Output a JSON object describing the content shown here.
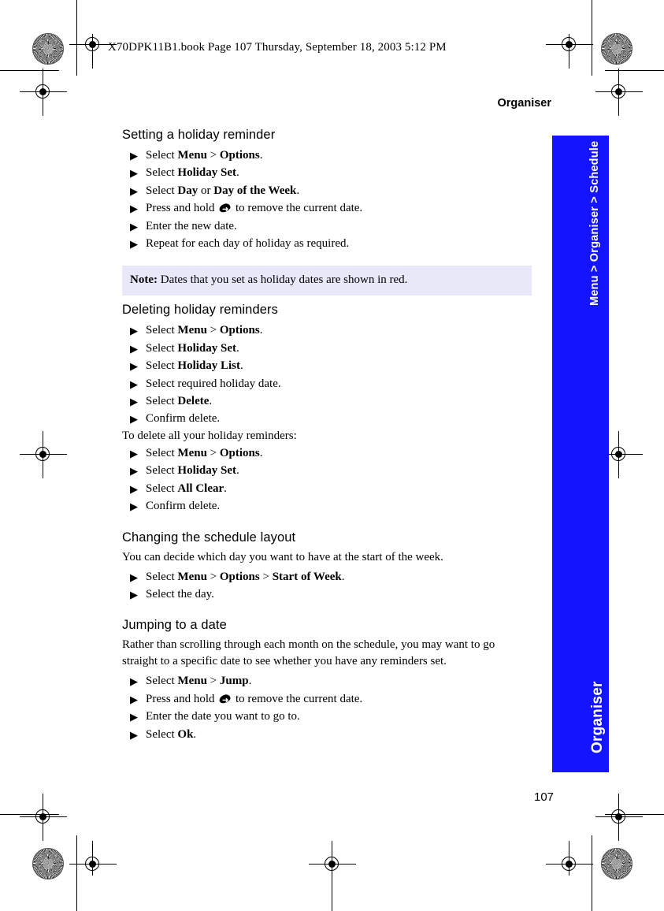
{
  "print_header": "X70DPK11B1.book  Page 107  Thursday, September 18, 2003  5:12 PM",
  "running_head": "Organiser",
  "folio": "107",
  "side_tab": {
    "breadcrumb": "Menu > Organiser > Schedule",
    "chapter": "Organiser",
    "color": "#1414ff"
  },
  "note": {
    "label": "Note:",
    "text": " Dates that you set as holiday dates are shown in red.",
    "background": "#e8e8f8"
  },
  "sections": [
    {
      "heading": "Setting a holiday reminder",
      "steps": [
        {
          "bullet": "▶",
          "parts": [
            {
              "t": "Select ",
              "b": false
            },
            {
              "t": "Menu",
              "b": true
            },
            {
              "t": " > ",
              "b": false
            },
            {
              "t": "Options",
              "b": true
            },
            {
              "t": ".",
              "b": false
            }
          ]
        },
        {
          "bullet": "▶",
          "parts": [
            {
              "t": "Select ",
              "b": false
            },
            {
              "t": "Holiday Set",
              "b": true
            },
            {
              "t": ".",
              "b": false
            }
          ]
        },
        {
          "bullet": "▶",
          "parts": [
            {
              "t": "Select ",
              "b": false
            },
            {
              "t": "Day",
              "b": true
            },
            {
              "t": " or ",
              "b": false
            },
            {
              "t": "Day of the Week",
              "b": true
            },
            {
              "t": ".",
              "b": false
            }
          ]
        },
        {
          "bullet": "▶",
          "icon": "clear-key-icon",
          "parts": [
            {
              "t": "Press and hold ",
              "b": false
            },
            {
              "t": " ",
              "b": false,
              "icon": true
            },
            {
              "t": " to remove the current date.",
              "b": false
            }
          ]
        },
        {
          "bullet": "▶",
          "parts": [
            {
              "t": "Enter the new date.",
              "b": false
            }
          ]
        },
        {
          "bullet": "▶",
          "parts": [
            {
              "t": "Repeat for each day of holiday as required.",
              "b": false
            }
          ]
        }
      ]
    },
    {
      "heading": "Deleting holiday reminders",
      "steps": [
        {
          "bullet": "▶",
          "parts": [
            {
              "t": "Select ",
              "b": false
            },
            {
              "t": "Menu",
              "b": true
            },
            {
              "t": " > ",
              "b": false
            },
            {
              "t": "Options",
              "b": true
            },
            {
              "t": ".",
              "b": false
            }
          ]
        },
        {
          "bullet": "▶",
          "parts": [
            {
              "t": "Select ",
              "b": false
            },
            {
              "t": "Holiday Set",
              "b": true
            },
            {
              "t": ".",
              "b": false
            }
          ]
        },
        {
          "bullet": "▶",
          "parts": [
            {
              "t": "Select ",
              "b": false
            },
            {
              "t": "Holiday List",
              "b": true
            },
            {
              "t": ".",
              "b": false
            }
          ]
        },
        {
          "bullet": "▶",
          "parts": [
            {
              "t": "Select required holiday date.",
              "b": false
            }
          ]
        },
        {
          "bullet": "▶",
          "parts": [
            {
              "t": "Select ",
              "b": false
            },
            {
              "t": "Delete",
              "b": true
            },
            {
              "t": ".",
              "b": false
            }
          ]
        },
        {
          "bullet": "▶",
          "parts": [
            {
              "t": "Confirm delete.",
              "b": false
            }
          ]
        }
      ],
      "lead_after": "To delete all your holiday reminders:",
      "steps2": [
        {
          "bullet": "▶",
          "parts": [
            {
              "t": "Select ",
              "b": false
            },
            {
              "t": "Menu",
              "b": true
            },
            {
              "t": " > ",
              "b": false
            },
            {
              "t": "Options",
              "b": true
            },
            {
              "t": ".",
              "b": false
            }
          ]
        },
        {
          "bullet": "▶",
          "parts": [
            {
              "t": "Select ",
              "b": false
            },
            {
              "t": "Holiday Set",
              "b": true
            },
            {
              "t": ".",
              "b": false
            }
          ]
        },
        {
          "bullet": "▶",
          "parts": [
            {
              "t": "Select ",
              "b": false
            },
            {
              "t": "All Clear",
              "b": true
            },
            {
              "t": ".",
              "b": false
            }
          ]
        },
        {
          "bullet": "▶",
          "parts": [
            {
              "t": "Confirm delete.",
              "b": false
            }
          ]
        }
      ]
    },
    {
      "heading": "Changing the schedule layout",
      "intro": "You can decide which day you want to have at the start of the week.",
      "steps": [
        {
          "bullet": "▶",
          "parts": [
            {
              "t": "Select ",
              "b": false
            },
            {
              "t": "Menu",
              "b": true
            },
            {
              "t": " > ",
              "b": false
            },
            {
              "t": "Options",
              "b": true
            },
            {
              "t": " > ",
              "b": false
            },
            {
              "t": "Start of Week",
              "b": true
            },
            {
              "t": ".",
              "b": false
            }
          ]
        },
        {
          "bullet": "▶",
          "parts": [
            {
              "t": "Select the day.",
              "b": false
            }
          ]
        }
      ]
    },
    {
      "heading": "Jumping to a date",
      "intro": "Rather than scrolling through each month on the schedule, you may want to go straight to a specific date to see whether you have any reminders set.",
      "steps": [
        {
          "bullet": "▶",
          "parts": [
            {
              "t": "Select ",
              "b": false
            },
            {
              "t": "Menu",
              "b": true
            },
            {
              "t": " > ",
              "b": false
            },
            {
              "t": "Jump",
              "b": true
            },
            {
              "t": ".",
              "b": false
            }
          ]
        },
        {
          "bullet": "▶",
          "icon": "clear-key-icon",
          "parts": [
            {
              "t": "Press and hold ",
              "b": false
            },
            {
              "t": " ",
              "b": false,
              "icon": true
            },
            {
              "t": " to remove the current date.",
              "b": false
            }
          ]
        },
        {
          "bullet": "▶",
          "parts": [
            {
              "t": "Enter the date you want to go to.",
              "b": false
            }
          ]
        },
        {
          "bullet": "▶",
          "parts": [
            {
              "t": "Select ",
              "b": false
            },
            {
              "t": "Ok",
              "b": true
            },
            {
              "t": ".",
              "b": false
            }
          ]
        }
      ]
    }
  ]
}
